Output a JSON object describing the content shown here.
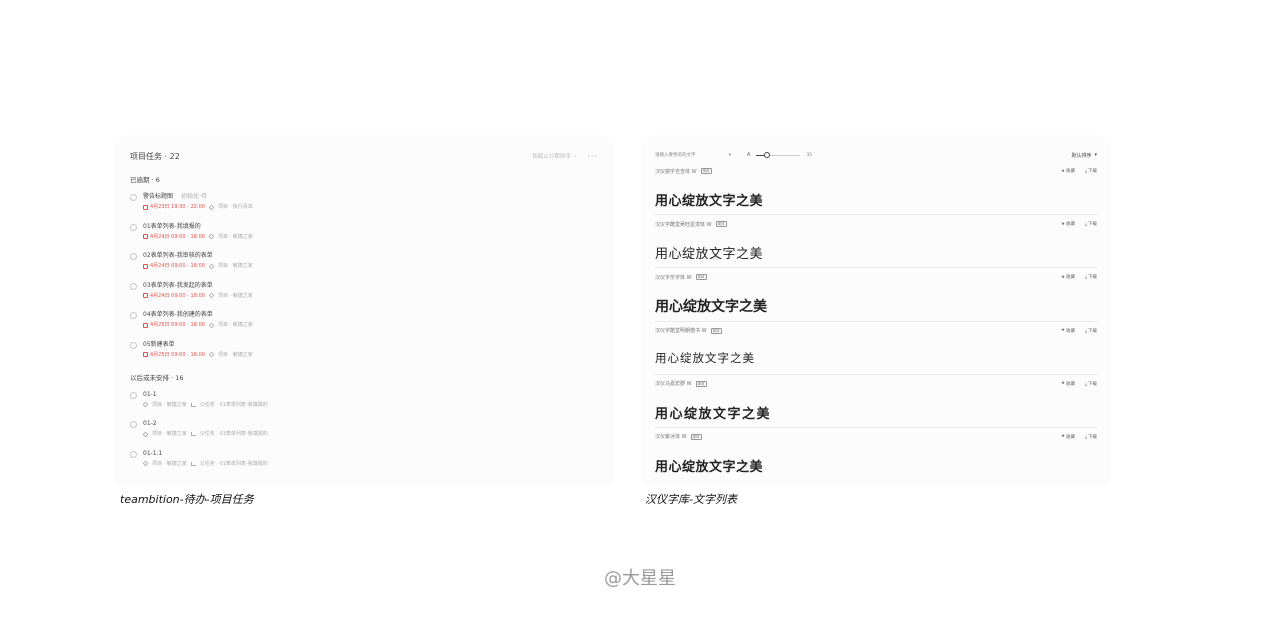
{
  "left_panel": {
    "title": "项目任务 · 22",
    "sort_label": "按截止日期排序",
    "more": "···",
    "section_overdue": "已逾期 · 6",
    "overdue_tasks": [
      {
        "title": "警告标题图",
        "tag": "初始化·待",
        "time": "4月23日 19:30 - 22:00",
        "project": "项目 · 执行清单"
      },
      {
        "title": "01表单列表-我填报的",
        "tag": "",
        "time": "4月24日 09:00 - 18:00",
        "project": "项目 · 敏捷之家"
      },
      {
        "title": "02表单列表-我审核的表单",
        "tag": "",
        "time": "4月24日 09:00 - 18:00",
        "project": "项目 · 敏捷之家"
      },
      {
        "title": "03表单列表-我发起的表单",
        "tag": "",
        "time": "4月24日 09:00 - 18:00",
        "project": "项目 · 敏捷之家"
      },
      {
        "title": "04表单列表-我创建的表单",
        "tag": "",
        "time": "4月25日 09:00 - 18:00",
        "project": "项目 · 敏捷之家"
      },
      {
        "title": "05新建表单",
        "tag": "",
        "time": "4月25日 09:00 - 18:00",
        "project": "项目 · 敏捷之家"
      }
    ],
    "section_later": "以后或未安排 · 16",
    "later_tasks": [
      {
        "title": "01-1",
        "project": "项目 · 敏捷之家",
        "parent": "父任务 · 01表单列表-我填报的"
      },
      {
        "title": "01-2",
        "project": "项目 · 敏捷之家",
        "parent": "父任务 · 01表单列表-我填报的"
      },
      {
        "title": "01-1.1",
        "project": "项目 · 敏捷之家",
        "parent": "父任务 · 01表单列表-我填报的"
      }
    ]
  },
  "right_panel": {
    "search_placeholder": "请输入要预览的文字",
    "search_arrow": "▾",
    "size_label": "A",
    "size_value": "35",
    "slider_level": 0.25,
    "sort_label": "默认排序",
    "sort_arrow": "▾",
    "fonts": [
      {
        "name": "汉仪镜字吉吉体 W",
        "badge": "简体",
        "collect": "收藏",
        "download": "下载",
        "sample": "用心绽放文字之美",
        "style": "s-bold"
      },
      {
        "name": "汉仪字酷堂吴旺星泼体 W",
        "badge": "简体",
        "collect": "收藏",
        "download": "下载",
        "sample": "用心绽放文字之美",
        "style": "s-regular"
      },
      {
        "name": "汉仪字乐字体 W",
        "badge": "简体",
        "collect": "收藏",
        "download": "下载",
        "sample": "用心绽放文字之美",
        "style": "s-heavy"
      },
      {
        "name": "汉仪字酷堂明朝楷书 W",
        "badge": "简体",
        "collect": "收藏",
        "download": "下载",
        "sample": "用心绽放文字之美",
        "style": "s-light"
      },
      {
        "name": "汉仪马嘉宏野 W",
        "badge": "简体",
        "collect": "收藏",
        "download": "下载",
        "sample": "用心绽放文字之美",
        "style": "s-brush"
      },
      {
        "name": "汉仪紫冰体 W",
        "badge": "简体",
        "collect": "收藏",
        "download": "下载",
        "sample": "用心绽放文字之美",
        "style": "s-bold"
      }
    ]
  },
  "captions": {
    "left": "teambition-待办-项目任务",
    "right": "汉仪字库-文字列表"
  },
  "watermark": "@大星星"
}
